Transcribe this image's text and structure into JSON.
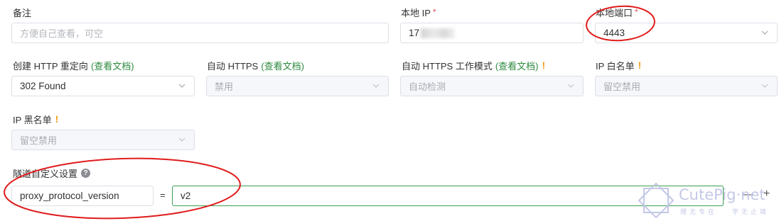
{
  "form": {
    "remark": {
      "label": "备注",
      "placeholder": "方便自己查看，可空"
    },
    "local_ip": {
      "label": "本地 IP",
      "required_mark": "*",
      "value": "17"
    },
    "local_port": {
      "label": "本地端口",
      "required_mark": "*",
      "value": "4443"
    },
    "http_redirect": {
      "label": "创建 HTTP 重定向",
      "doc_link": "(查看文档)",
      "value": "302 Found"
    },
    "auto_https": {
      "label": "自动 HTTPS",
      "doc_link": "(查看文档)",
      "value": "禁用"
    },
    "auto_https_mode": {
      "label": "自动 HTTPS 工作模式",
      "doc_link": "(查看文档)",
      "warn": "!",
      "value": "自动检测"
    },
    "ip_whitelist": {
      "label": "IP 白名单",
      "warn": "!",
      "value": "留空禁用"
    },
    "ip_blacklist": {
      "label": "IP 黑名单",
      "warn": "!",
      "value": "留空禁用"
    },
    "tunnel_custom": {
      "label": "隧道自定义设置",
      "help": "?",
      "key": "proxy_protocol_version",
      "equals": "=",
      "value": "v2",
      "remove": "—",
      "add": "+"
    }
  },
  "watermark": {
    "brand": "CutePig·net",
    "slogan_left": "理无专在",
    "slogan_right": "学无止境"
  },
  "colors": {
    "accent_green": "#3a9e4f",
    "annotation_red": "#e01b1b",
    "required_red": "#e04b4b",
    "warning_orange": "#f0a020"
  }
}
